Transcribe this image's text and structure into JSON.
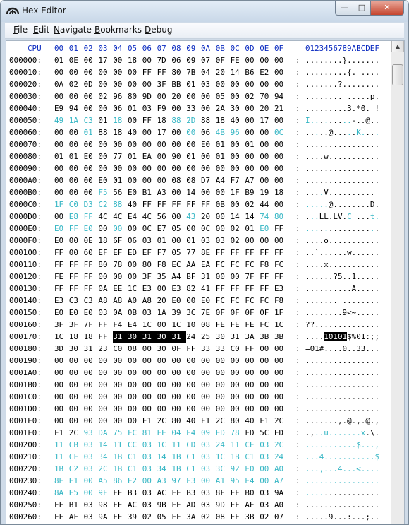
{
  "window": {
    "title": "Hex Editor",
    "icon": "hex-editor-app-icon",
    "controls": {
      "minimize": "—",
      "maximize": "□",
      "close": "✕"
    }
  },
  "menu": [
    "File",
    "Edit",
    "Navigate",
    "Bookmarks",
    "Debug"
  ],
  "menu_mnemonics": [
    "F",
    "E",
    "N",
    "B",
    "D"
  ],
  "colors": {
    "header": "#0b2bc0",
    "highlight": "#35b6c4",
    "selection": "#000000"
  },
  "header": {
    "addr": "CPU",
    "cols": [
      "00",
      "01",
      "02",
      "03",
      "04",
      "05",
      "06",
      "07",
      "08",
      "09",
      "0A",
      "0B",
      "0C",
      "0D",
      "0E",
      "0F"
    ],
    "ascii": "0123456789ABCDEF"
  },
  "rows": [
    {
      "addr": "000000:",
      "bytes": "01 0E 00 17 00 18 00 7D 06 09 07 0F FE 00 00 00",
      "ascii": "........}......."
    },
    {
      "addr": "000010:",
      "bytes": "00 00 00 00 00 00 FF FF 80 7B 04 20 14 B6 E2 00",
      "ascii": ".........{. ...."
    },
    {
      "addr": "000020:",
      "bytes": "0A 02 0D 00 00 00 00 3F BB 01 03 00 00 00 00 00",
      "ascii": ".......?........"
    },
    {
      "addr": "000030:",
      "bytes": "00 00 00 02 96 80 9D 00 20 00 00 05 00 02 70 94",
      "ascii": "........ .....p."
    },
    {
      "addr": "000040:",
      "bytes": "E9 94 00 00 06 01 03 F9 00 33 00 2A 30 00 20 21",
      "ascii": ".........3.*0. !"
    },
    {
      "addr": "000050:",
      "bytes": "49 1A C3 01 18 00 FF 18 88 2D 88 18 40 00 17 00",
      "ascii": "I.........-..@..",
      "hl": [
        0,
        1,
        2,
        4,
        8,
        9
      ]
    },
    {
      "addr": "000060:",
      "bytes": "00 00 01 88 18 40 00 17 00 00 06 4B 96 00 00 0C",
      "ascii": ".....@.....K....",
      "hl": [
        2,
        9,
        11,
        12,
        15
      ]
    },
    {
      "addr": "000070:",
      "bytes": "00 00 00 00 00 00 00 00 00 00 E0 01 00 01 00 00",
      "ascii": "................"
    },
    {
      "addr": "000080:",
      "bytes": "01 01 E0 00 77 01 EA 00 90 01 00 01 00 00 00 00",
      "ascii": "....w..........."
    },
    {
      "addr": "000090:",
      "bytes": "00 00 00 00 00 00 00 00 00 00 00 00 00 00 00 00",
      "ascii": "................"
    },
    {
      "addr": "0000A0:",
      "bytes": "00 00 00 E0 01 00 00 00 08 08 D7 A4 F7 A7 00 00",
      "ascii": "................"
    },
    {
      "addr": "0000B0:",
      "bytes": "00 00 00 F5 56 E0 B1 A3 00 14 00 00 1F B9 19 18",
      "ascii": "....V..........",
      "hl": [
        3
      ]
    },
    {
      "addr": "0000C0:",
      "bytes": "1F C0 D3 C2 88 40 FF FF FF FF FF 0B 00 02 44 00",
      "ascii": ".....@........D.",
      "hl": [
        0,
        1,
        2,
        3,
        4
      ]
    },
    {
      "addr": "0000D0:",
      "bytes": "00 E8 FF 4C 4C E4 4C 56 00 43 20 00 14 14 74 80",
      "ascii": "...LL.LV.C ...t.",
      "hl": [
        1,
        2,
        9,
        14,
        15
      ]
    },
    {
      "addr": "0000E0:",
      "bytes": "E0 FF E0 00 00 00 0C E7 05 00 0C 00 02 01 E0 FF",
      "ascii": "................",
      "hl": [
        0,
        1,
        2,
        4,
        14
      ]
    },
    {
      "addr": "0000F0:",
      "bytes": "E0 00 0E 18 6F 06 03 01 00 01 03 03 02 00 00 00",
      "ascii": "....o..........."
    },
    {
      "addr": "000100:",
      "bytes": "FF 00 60 EF EF ED EF F7 05 77 8E FF FF FF FF FF",
      "ascii": "..`......w......"
    },
    {
      "addr": "000110:",
      "bytes": "FF FF FF 80 78 00 80 F8 EC AA EA FC FC FC F8 FC",
      "ascii": "....x..........."
    },
    {
      "addr": "000120:",
      "bytes": "FE FF FF 00 00 00 3F 35 A4 BF 31 00 00 7F FF FF",
      "ascii": "......?5..1....."
    },
    {
      "addr": "000130:",
      "bytes": "FF FF FF 0A EE 1C E3 00 E3 82 41 FF FF FF FF E3",
      "ascii": "..........A....."
    },
    {
      "addr": "000140:",
      "bytes": "E3 C3 C3 A8 A8 A0 A8 20 E0 00 E0 FC FC FC FC F8",
      "ascii": "....... ........"
    },
    {
      "addr": "000150:",
      "bytes": "E0 E0 E0 03 0A 0B 03 1A 39 3C 7E 0F 0F 0F 0F 1F",
      "ascii": "........9<~....."
    },
    {
      "addr": "000160:",
      "bytes": "3F 3F 7F FF F4 E4 1C 00 1C 10 08 FE FE FE FC 1C",
      "ascii": "??.............."
    },
    {
      "addr": "000170:",
      "bytes": "1C 18 18 FF 31 30 31 30 31 24 25 30 31 3A 3B 3B",
      "ascii": "....10101$%01:;;",
      "sel": [
        4,
        5,
        6,
        7,
        8
      ]
    },
    {
      "addr": "000180:",
      "bytes": "3D 30 31 23 C0 08 00 30 0F FF 33 33 C0 FF 00 00",
      "ascii": "=01#....0..33..."
    },
    {
      "addr": "000190:",
      "bytes": "00 00 00 00 00 00 00 00 00 00 00 00 00 00 00 00",
      "ascii": "................"
    },
    {
      "addr": "0001A0:",
      "bytes": "00 00 00 00 00 00 00 00 00 00 00 00 00 00 00 00",
      "ascii": "................"
    },
    {
      "addr": "0001B0:",
      "bytes": "00 00 00 00 00 00 00 00 00 00 00 00 00 00 00 00",
      "ascii": "................"
    },
    {
      "addr": "0001C0:",
      "bytes": "00 00 00 00 00 00 00 00 00 00 00 00 00 00 00 00",
      "ascii": "................"
    },
    {
      "addr": "0001D0:",
      "bytes": "00 00 00 00 00 00 00 00 00 00 00 00 00 00 00 00",
      "ascii": "................"
    },
    {
      "addr": "0001E0:",
      "bytes": "00 00 00 00 00 00 F1 2C 80 40 F1 2C 80 40 F1 2C",
      "ascii": ".......,.@.,.@.,"
    },
    {
      "addr": "0001F0:",
      "bytes": "F1 2C 93 DA 75 FC 81 EE 04 E4 09 ED 78 FD 5C ED",
      "ascii": ".,..u.......x.\\.",
      "hl": [
        2,
        3,
        4,
        5,
        6,
        7,
        8,
        9,
        10,
        11,
        12
      ]
    },
    {
      "addr": "000200:",
      "bytes": "11 CB 03 14 11 CC 03 1C 11 CD 03 24 11 CE 03 2C",
      "ascii": "...........$...,",
      "hl": [
        0,
        1,
        2,
        3,
        4,
        5,
        6,
        7,
        8,
        9,
        10,
        11,
        12,
        13,
        14,
        15
      ]
    },
    {
      "addr": "000210:",
      "bytes": "11 CF 03 34 1B C1 03 14 1B C1 03 1C 1B C1 03 24",
      "ascii": "...4...........$",
      "hl": [
        0,
        1,
        2,
        3,
        4,
        5,
        6,
        7,
        8,
        9,
        10,
        11,
        12,
        13,
        14,
        15
      ]
    },
    {
      "addr": "000220:",
      "bytes": "1B C2 03 2C 1B C1 03 34 1B C1 03 3C 92 E0 00 A0",
      "ascii": "...,...4...<....",
      "hl": [
        0,
        1,
        2,
        3,
        4,
        5,
        6,
        7,
        8,
        9,
        10,
        11,
        12,
        13,
        14,
        15
      ]
    },
    {
      "addr": "000230:",
      "bytes": "8E E1 00 A5 86 E2 00 A3 97 E3 00 A1 95 E4 00 A7",
      "ascii": "................",
      "hl": [
        0,
        1,
        2,
        3,
        4,
        5,
        6,
        7,
        8,
        9,
        10,
        11,
        12,
        13,
        14,
        15
      ]
    },
    {
      "addr": "000240:",
      "bytes": "8A E5 00 9F FF B3 03 AC FF B3 03 8F FF B0 03 9A",
      "ascii": "................",
      "hl": [
        0,
        1,
        2,
        3
      ]
    },
    {
      "addr": "000250:",
      "bytes": "FF B1 03 98 FF AC 03 9B FF AD 03 9D FF AE 03 A0",
      "ascii": "................"
    },
    {
      "addr": "000260:",
      "bytes": "FF AF 03 9A FF 39 02 05 FF 3A 02 08 FF 3B 02 07",
      "ascii": ".....9...:...;.."
    }
  ]
}
